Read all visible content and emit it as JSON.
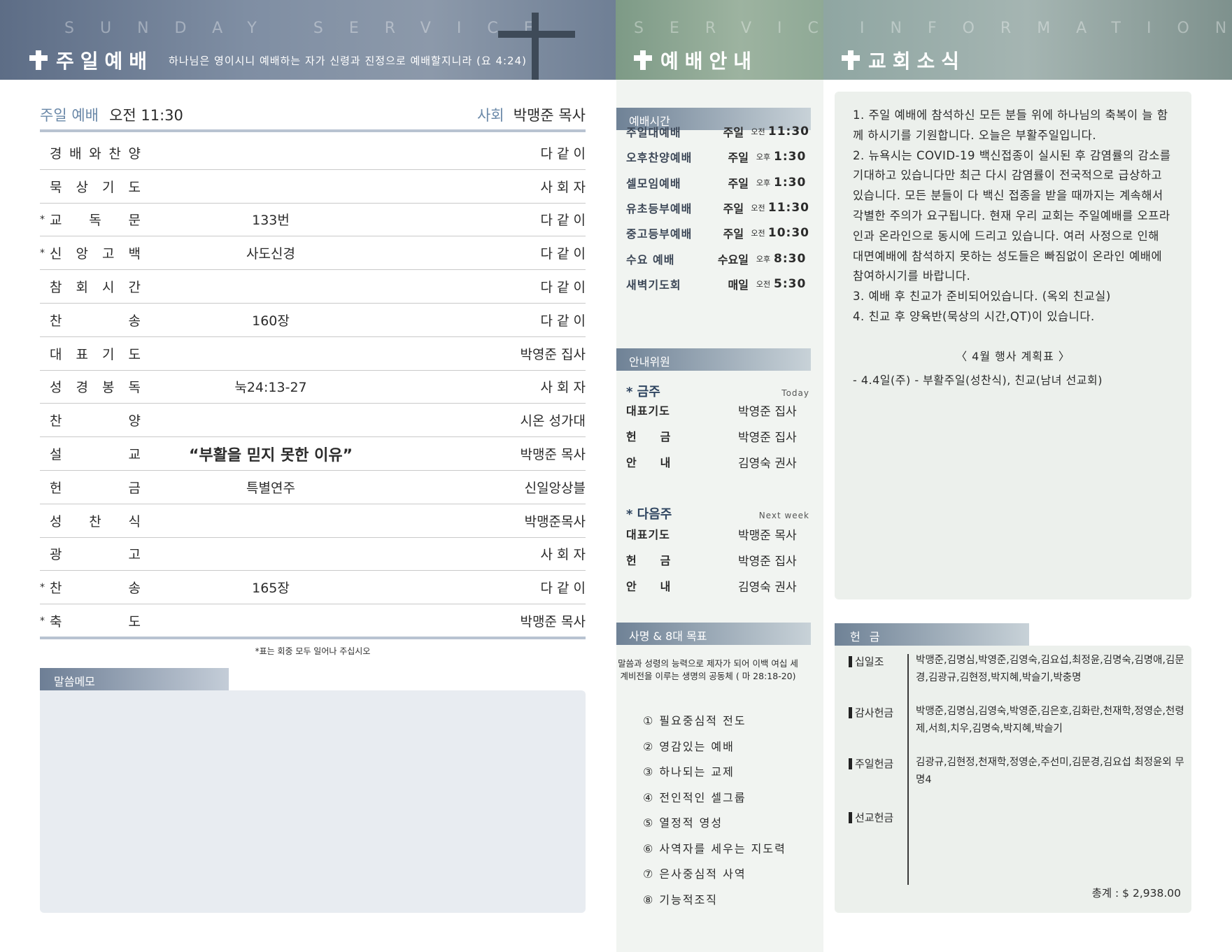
{
  "header": {
    "left": {
      "spaced": "SUNDAY SERVICE",
      "title": "주일예배",
      "verse": "하나님은 영이시니 예배하는 자가 신령과 진정으로 예배할지니라 (요 4:24)"
    },
    "middle": {
      "spaced": "SERVICE",
      "title": "예배안내"
    },
    "right": {
      "spaced": "INFORMATION",
      "title": "교회소식"
    }
  },
  "service": {
    "label": "주일 예배",
    "time": "오전 11:30",
    "leader_label": "사회",
    "leader": "박맹준 목사",
    "order": [
      {
        "star": "",
        "name": [
          "경",
          "배",
          "와",
          "찬",
          "양"
        ],
        "content": "",
        "leader": "다 같 이"
      },
      {
        "star": "",
        "name": [
          "묵",
          "상",
          "기",
          "도"
        ],
        "content": "",
        "leader": "사 회 자"
      },
      {
        "star": "*",
        "name": [
          "교",
          "독",
          "문"
        ],
        "content": "133번",
        "leader": "다 같 이"
      },
      {
        "star": "*",
        "name": [
          "신",
          "앙",
          "고",
          "백"
        ],
        "content": "사도신경",
        "leader": "다 같 이"
      },
      {
        "star": "",
        "name": [
          "참",
          "회",
          "시",
          "간"
        ],
        "content": "",
        "leader": "다 같 이"
      },
      {
        "star": "",
        "name": [
          "찬",
          "송"
        ],
        "content": "160장",
        "leader": "다 같 이"
      },
      {
        "star": "",
        "name": [
          "대",
          "표",
          "기",
          "도"
        ],
        "content": "",
        "leader": "박영준 집사"
      },
      {
        "star": "",
        "name": [
          "성",
          "경",
          "봉",
          "독"
        ],
        "content": "눅24:13-27",
        "leader": "사 회 자"
      },
      {
        "star": "",
        "name": [
          "찬",
          "양"
        ],
        "content": "",
        "leader": "시온 성가대"
      },
      {
        "star": "",
        "name": [
          "설",
          "교"
        ],
        "content": "“부활을 믿지 못한 이유”",
        "leader": "박맹준 목사"
      },
      {
        "star": "",
        "name": [
          "헌",
          "금"
        ],
        "content": "특별연주",
        "leader": "신일앙상블"
      },
      {
        "star": "",
        "name": [
          "성",
          "찬",
          "식"
        ],
        "content": "",
        "leader": "박맹준목사"
      },
      {
        "star": "",
        "name": [
          "광",
          "고"
        ],
        "content": "",
        "leader": "사 회 자"
      },
      {
        "star": "*",
        "name": [
          "찬",
          "송"
        ],
        "content": "165장",
        "leader": "다 같 이"
      },
      {
        "star": "*",
        "name": [
          "축",
          "도"
        ],
        "content": "",
        "leader": "박맹준 목사"
      }
    ],
    "stand_note": "*표는 회중 모두 일어나 주십시오",
    "memo_label": "말씀메모"
  },
  "schedule": {
    "tab": "예배시간",
    "items": [
      {
        "name": "주일대예배",
        "day": "주일",
        "ampm": "오전",
        "time": "11:30"
      },
      {
        "name": "오후찬양예배",
        "day": "주일",
        "ampm": "오후",
        "time": "1:30"
      },
      {
        "name": "셀모임예배",
        "day": "주일",
        "ampm": "오후",
        "time": "1:30"
      },
      {
        "name": "유초등부예배",
        "day": "주일",
        "ampm": "오전",
        "time": "11:30"
      },
      {
        "name": "중고등부예배",
        "day": "주일",
        "ampm": "오전",
        "time": "10:30"
      },
      {
        "name": "수요 예배",
        "day": "수요일",
        "ampm": "오후",
        "time": "8:30"
      },
      {
        "name": "새벽기도회",
        "day": "매일",
        "ampm": "오전",
        "time": "5:30"
      }
    ]
  },
  "ushers": {
    "tab": "안내위원",
    "this_week": {
      "label": "* 금주",
      "tag": "Today",
      "items": [
        {
          "role": "대표기도",
          "name": "박영준 집사"
        },
        {
          "role": "헌     금",
          "name": "박영준 집사"
        },
        {
          "role": "안     내",
          "name": "김영숙 권사"
        }
      ]
    },
    "next_week": {
      "label": "* 다음주",
      "tag": "Next week",
      "items": [
        {
          "role": "대표기도",
          "name": "박맹준 목사"
        },
        {
          "role": "헌     금",
          "name": "박영준 집사"
        },
        {
          "role": "안     내",
          "name": "김영숙 권사"
        }
      ]
    }
  },
  "mission": {
    "tab": "사명 & 8대 목표",
    "text": "말씀과 성령의 능력으로 제자가 되어 이백 여십 세계비전을 이루는 생명의 공동체 ( 마 28:18-20)",
    "goals": [
      "① 필요중심적 전도",
      "② 영감있는 예배",
      "③ 하나되는 교제",
      "④ 전인적인 셀그룹",
      "⑤ 열정적 영성",
      "⑥ 사역자를 세우는 지도력",
      "⑦ 은사중심적 사역",
      "⑧ 기능적조직"
    ]
  },
  "news": {
    "items": [
      "1. 주일 예배에 참석하신 모든 분들 위에 하나님의 축복이 늘 함께 하시기를 기원합니다. 오늘은 부활주일입니다.",
      "2. 뉴욕시는 COVID-19 백신접종이 실시된 후 감염률의 감소를 기대하고 있습니다만 최근 다시 감염률이 전국적으로 급상하고 있습니다. 모든 분들이 다 백신 접종을 받을 때까지는 계속해서 각별한 주의가 요구됩니다. 현재 우리 교회는 주일예배를 오프라인과 온라인으로 동시에 드리고 있습니다. 여러 사정으로 인해 대면예배에 참석하지 못하는 성도들은 빠짐없이 온라인 예배에 참여하시기를 바랍니다.",
      "3. 예배 후 친교가 준비되어있습니다. (옥외 친교실)",
      "4. 친교 후 양육반(묵상의 시간,QT)이 있습니다."
    ],
    "plan_title": "〈  4월 행사 계획표  〉",
    "plan_item": "-    4.4일(주) - 부활주일(성찬식), 친교(남녀 선교회)"
  },
  "offering": {
    "tab": "헌 금",
    "categories": [
      {
        "label": "십일조",
        "names": "박맹준,김명심,박영준,김영숙,김요섭,최정윤,김명숙,김명애,김문경,김광규,김현정,박지혜,박슬기,박충명"
      },
      {
        "label": "감사헌금",
        "names": "박맹준,김명심,김영숙,박영준,김은호,김화란,천재학,정영순,천령제,서희,치우,김명숙,박지혜,박슬기"
      },
      {
        "label": "주일헌금",
        "names": "김광규,김현정,천재학,정영순,주선미,김문경,김요섭 최정윤외 무명4"
      },
      {
        "label": "선교헌금",
        "names": ""
      }
    ],
    "total": "총계 : $ 2,938.00"
  }
}
